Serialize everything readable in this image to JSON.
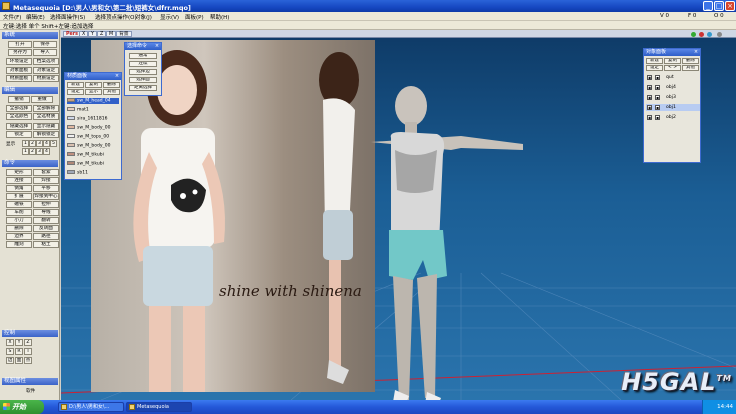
{
  "window": {
    "title": "Metasequoia [D:\\男人\\男和女\\第二批\\短裤女\\dfrr.mqo]"
  },
  "menu": [
    "文件(F)",
    "编辑(E)",
    "选择面操作(S)",
    "选择顶点操作(O)",
    "对象(J)",
    "显示(V)",
    "面板(P)",
    "帮助(H)"
  ],
  "readouts": {
    "v": "V 0",
    "f": "F 0",
    "o": "O 0"
  },
  "toolbar2": {
    "hint": "左键:选择 单个 Shift+左键:追加选择"
  },
  "left_panel": {
    "system": {
      "title": "系统",
      "buttons": [
        "打开",
        "保存",
        "另存为",
        "导入",
        "环境设定",
        "档案选项",
        "对象面板",
        "对象设定",
        "材质面板",
        "材质设定"
      ]
    },
    "edit": {
      "title": "编辑",
      "buttons": [
        "撤销",
        "重做",
        "全部选择",
        "全部解除",
        "全选颜色",
        "全选材质",
        "隐藏选择",
        "显示隐藏",
        "锁定",
        "解锁锁定"
      ],
      "num_label": "显示",
      "numbers": [
        "1",
        "2",
        "3",
        "4",
        "5",
        "1",
        "2",
        "3",
        "4"
      ]
    },
    "command": {
      "title": "命令",
      "buttons": [
        "选择",
        "移动",
        "缩放",
        "旋转",
        "平滑",
        "光滑",
        "挤出",
        "倒角",
        "小刀",
        "镜像",
        "文本",
        "曲线",
        "平面",
        "拉伸"
      ],
      "labels": [
        "矩形",
        "套索",
        "连接",
        "焊接",
        "倒角",
        "平移",
        "扩展",
        "焊接到中心",
        "磁铁",
        "拉伸",
        "车削",
        "导线",
        "小刀",
        "翻转",
        "删除",
        "反转面",
        "边界",
        "路径",
        "雕刻",
        "粘土"
      ]
    },
    "control": {
      "title": "控制",
      "buttons": [
        "X",
        "Y",
        "Z",
        "S",
        "R",
        "T",
        "边",
        "面",
        "点"
      ]
    },
    "bottom": {
      "title": "视图属性",
      "label": "软件"
    }
  },
  "viewport": {
    "tabs": [
      "Pers",
      "X",
      "Y",
      "Z",
      "M",
      "背景"
    ],
    "photo_text": "shine with shinena",
    "logo": "H5GAL",
    "logo_tm": "TM"
  },
  "panels": {
    "selection": {
      "title": "选择命令",
      "buttons": [
        "通常",
        "连续",
        "选择边",
        "选择面",
        "距离选择"
      ]
    },
    "material": {
      "title": "材质面板",
      "buttons": [
        "新建",
        "复制",
        "删除",
        "设定",
        "显示",
        "其他"
      ],
      "items": [
        {
          "name": "sw_M_head_04",
          "color": "#c8a080",
          "selected": true
        },
        {
          "name": "mat1",
          "color": "#e8d0c0",
          "selected": false
        },
        {
          "name": "sira_1611816",
          "color": "#d0d8e8",
          "selected": false
        },
        {
          "name": "sw_M_body_00",
          "color": "#e0b8a0",
          "selected": false
        },
        {
          "name": "sw_M_tops_00",
          "color": "#f0f0f0",
          "selected": false
        },
        {
          "name": "sw_M_body_00",
          "color": "#d8c0b0",
          "selected": false
        },
        {
          "name": "sw_M_tikubi",
          "color": "#c09080",
          "selected": false
        },
        {
          "name": "sw_M_tikubi",
          "color": "#b08878",
          "selected": false
        },
        {
          "name": "sb11",
          "color": "#a0a8b8",
          "selected": false
        }
      ]
    },
    "object": {
      "title": "对象面板",
      "buttons": [
        "新建",
        "复制",
        "删除",
        "设定",
        "< >",
        "其他"
      ],
      "items": [
        {
          "name": "qut",
          "selected": false
        },
        {
          "name": "obj4",
          "selected": false
        },
        {
          "name": "obj3",
          "selected": false
        },
        {
          "name": "obj1",
          "selected": true
        },
        {
          "name": "obj2",
          "selected": false
        }
      ]
    }
  },
  "taskbar": {
    "start": "开始",
    "tasks": [
      "D:\\男人\\男和女\\...",
      "Metasequoia"
    ],
    "clock": "14:44"
  },
  "colors": {
    "accent": "#2458d8",
    "viewport_bg": "#1b5e95",
    "selected": "#3160c8"
  }
}
